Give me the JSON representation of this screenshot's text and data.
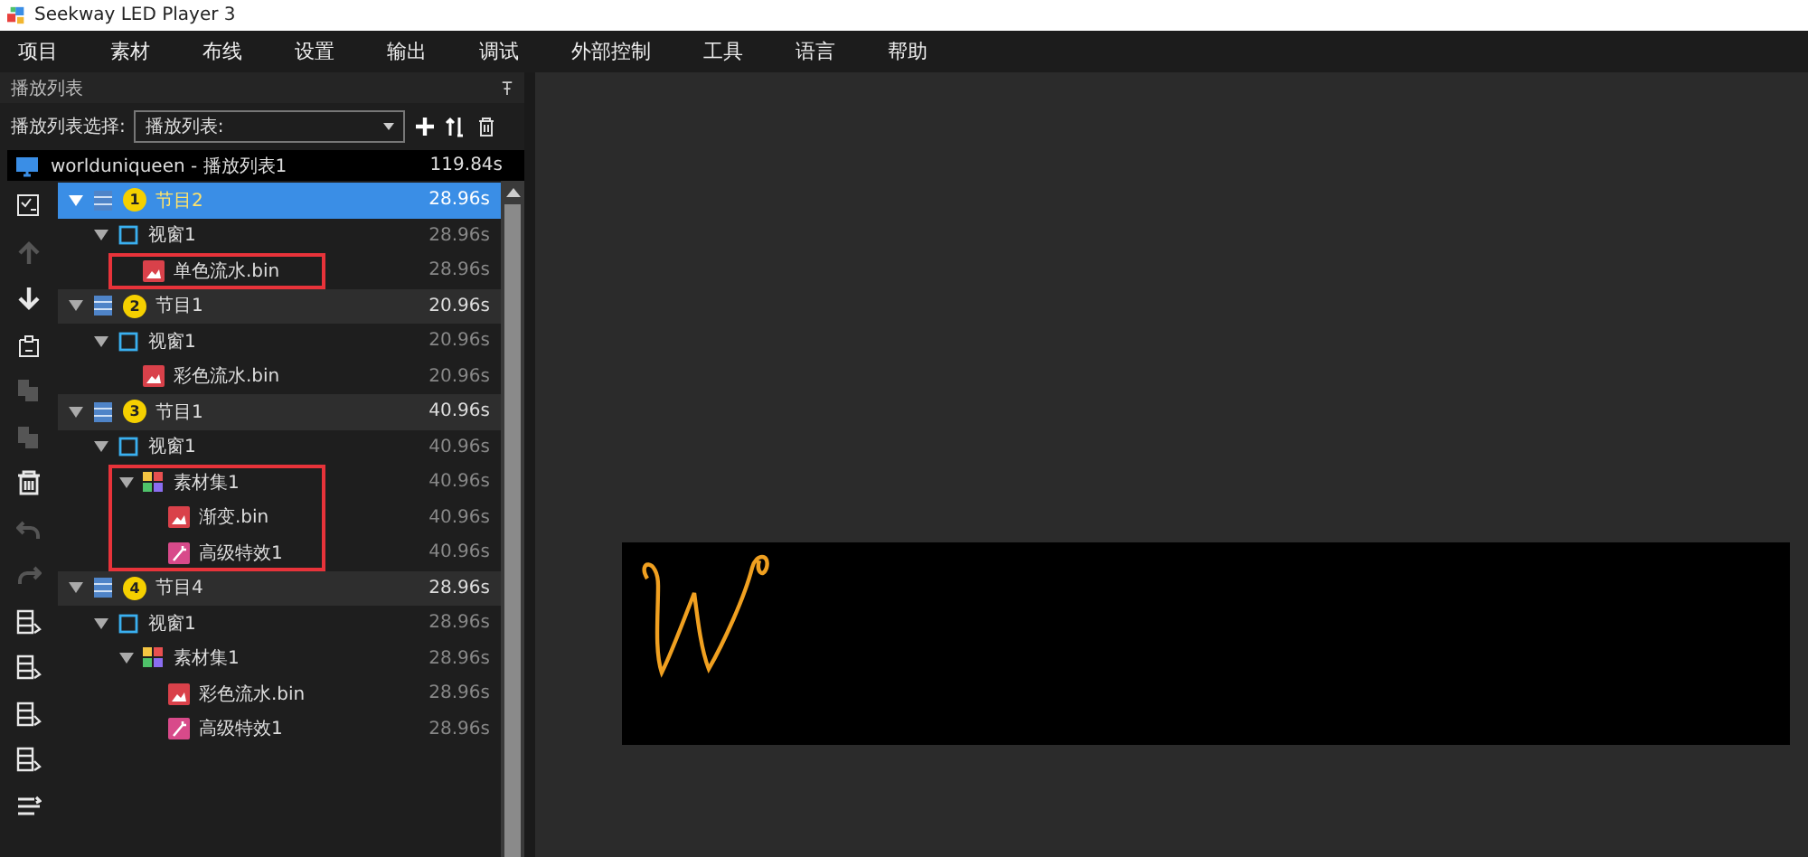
{
  "window": {
    "title": "Seekway LED Player 3"
  },
  "menu": [
    "项目",
    "素材",
    "布线",
    "设置",
    "输出",
    "调试",
    "外部控制",
    "工具",
    "语言",
    "帮助"
  ],
  "panel": {
    "title": "播放列表",
    "selector_label": "播放列表选择:",
    "selector_value": "播放列表:"
  },
  "tools": [
    {
      "kind": "check",
      "disabled": false
    },
    {
      "kind": "up",
      "disabled": true
    },
    {
      "kind": "down",
      "disabled": false
    },
    {
      "kind": "paste",
      "disabled": false
    },
    {
      "kind": "copy",
      "disabled": true
    },
    {
      "kind": "copy",
      "disabled": true
    },
    {
      "kind": "trash",
      "disabled": false
    },
    {
      "kind": "undo",
      "disabled": true
    },
    {
      "kind": "redo",
      "disabled": true
    },
    {
      "kind": "layout",
      "disabled": false
    },
    {
      "kind": "layout",
      "disabled": false
    },
    {
      "kind": "layout",
      "disabled": false
    },
    {
      "kind": "layout",
      "disabled": false
    },
    {
      "kind": "list",
      "disabled": false
    }
  ],
  "playlist": {
    "name": "worlduniqueen - 播放列表1",
    "duration": "119.84s"
  },
  "tree": [
    {
      "kind": "program",
      "badge": "1",
      "label": "节目2",
      "duration": "28.96s",
      "selected": true,
      "expanded": true,
      "highlighted": false,
      "children": [
        {
          "kind": "window",
          "label": "视窗1",
          "duration": "28.96s",
          "selected": false,
          "expanded": true,
          "highlighted": false,
          "children": [
            {
              "kind": "file",
              "label": "单色流水.bin",
              "duration": "28.96s",
              "selected": false,
              "highlighted": true
            }
          ]
        }
      ]
    },
    {
      "kind": "program",
      "badge": "2",
      "label": "节目1",
      "duration": "20.96s",
      "selected": false,
      "expanded": true,
      "highlighted": false,
      "children": [
        {
          "kind": "window",
          "label": "视窗1",
          "duration": "20.96s",
          "selected": false,
          "expanded": true,
          "highlighted": false,
          "children": [
            {
              "kind": "file",
              "label": "彩色流水.bin",
              "duration": "20.96s",
              "selected": false,
              "highlighted": false
            }
          ]
        }
      ]
    },
    {
      "kind": "program",
      "badge": "3",
      "label": "节目1",
      "duration": "40.96s",
      "selected": false,
      "expanded": true,
      "highlighted": false,
      "children": [
        {
          "kind": "window",
          "label": "视窗1",
          "duration": "40.96s",
          "selected": false,
          "expanded": true,
          "highlighted": false,
          "children": [
            {
              "kind": "group",
              "label": "素材集1",
              "duration": "40.96s",
              "selected": false,
              "expanded": true,
              "highlighted": true,
              "children": [
                {
                  "kind": "file",
                  "label": "渐变.bin",
                  "duration": "40.96s",
                  "selected": false,
                  "highlighted": false
                },
                {
                  "kind": "effect",
                  "label": "高级特效1",
                  "duration": "40.96s",
                  "selected": false,
                  "highlighted": false
                }
              ]
            }
          ]
        }
      ]
    },
    {
      "kind": "program",
      "badge": "4",
      "label": "节目4",
      "duration": "28.96s",
      "selected": false,
      "expanded": true,
      "highlighted": false,
      "children": [
        {
          "kind": "window",
          "label": "视窗1",
          "duration": "28.96s",
          "selected": false,
          "expanded": true,
          "highlighted": false,
          "children": [
            {
              "kind": "group",
              "label": "素材集1",
              "duration": "28.96s",
              "selected": false,
              "expanded": true,
              "highlighted": false,
              "children": [
                {
                  "kind": "file",
                  "label": "彩色流水.bin",
                  "duration": "28.96s",
                  "selected": false,
                  "highlighted": false
                },
                {
                  "kind": "effect",
                  "label": "高级特效1",
                  "duration": "28.96s",
                  "selected": false,
                  "highlighted": false
                }
              ]
            }
          ]
        }
      ]
    }
  ]
}
